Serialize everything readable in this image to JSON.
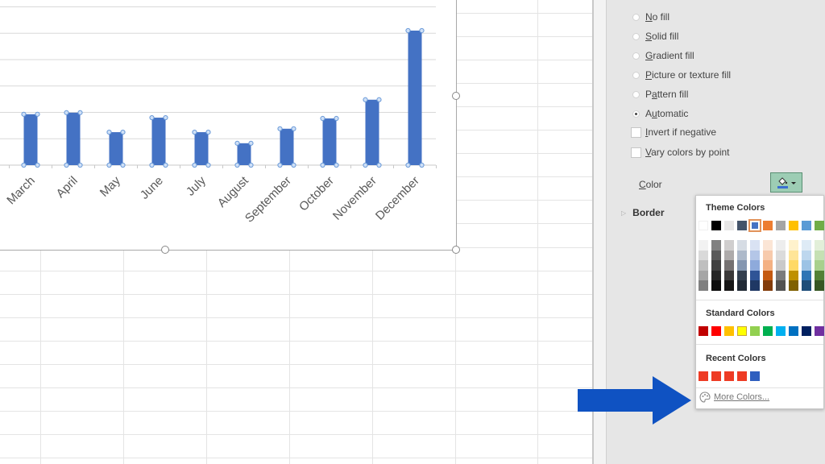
{
  "chart_data": {
    "type": "bar",
    "title": "",
    "xlabel": "",
    "ylabel": "",
    "categories": [
      "March",
      "April",
      "May",
      "June",
      "July",
      "August",
      "September",
      "October",
      "November",
      "December"
    ],
    "values": [
      1.93,
      1.99,
      1.25,
      1.8,
      1.25,
      0.83,
      1.38,
      1.77,
      2.48,
      5.1
    ],
    "value_units": "gridline intervals (axis labels not visible)",
    "ylim": [
      0,
      6
    ],
    "grid": true,
    "legend": "none",
    "bar_color": "#4472C4",
    "selected": true
  },
  "format_panel": {
    "fill_options": [
      {
        "label": "No fill",
        "accel": "N",
        "selected": false
      },
      {
        "label": "Solid fill",
        "accel": "S",
        "selected": false
      },
      {
        "label": "Gradient fill",
        "accel": "G",
        "selected": false
      },
      {
        "label": "Picture or texture fill",
        "accel": "P",
        "selected": false
      },
      {
        "label": "Pattern fill",
        "accel": "a",
        "selected": false
      },
      {
        "label": "Automatic",
        "accel": "u",
        "selected": true
      }
    ],
    "checkboxes": [
      {
        "label": "Invert if negative",
        "checked": false
      },
      {
        "label": "Vary colors by point",
        "checked": false
      }
    ],
    "color_label": "Color",
    "color_button_icon": "paint-bucket-icon",
    "border_label": "Border"
  },
  "color_picker": {
    "theme_header": "Theme Colors",
    "theme_colors": [
      "#FFFFFF",
      "#000000",
      "#E7E6E6",
      "#44546A",
      "#4472C4",
      "#ED7D31",
      "#A5A5A5",
      "#FFC000",
      "#5B9BD5",
      "#70AD47"
    ],
    "theme_selected_index": 4,
    "theme_shades": [
      [
        "#F2F2F2",
        "#D9D9D9",
        "#BFBFBF",
        "#A6A6A6",
        "#808080"
      ],
      [
        "#808080",
        "#595959",
        "#404040",
        "#262626",
        "#0D0D0D"
      ],
      [
        "#D0CECE",
        "#AEABAB",
        "#757171",
        "#3A3838",
        "#171616"
      ],
      [
        "#D6DCE4",
        "#ADB9CA",
        "#8496B0",
        "#333F4F",
        "#222A35"
      ],
      [
        "#D9E2F3",
        "#B4C6E7",
        "#8EAADB",
        "#2F5496",
        "#1F3864"
      ],
      [
        "#FBE5D5",
        "#F7CAAC",
        "#F4B183",
        "#C55A11",
        "#833C0B"
      ],
      [
        "#EDEDED",
        "#DBDBDB",
        "#C9C9C9",
        "#7B7B7B",
        "#525252"
      ],
      [
        "#FFF2CC",
        "#FFE598",
        "#FFD965",
        "#BF9000",
        "#7F6000"
      ],
      [
        "#DEEBF6",
        "#BDD7EE",
        "#9CC3E5",
        "#2E75B5",
        "#1E4E79"
      ],
      [
        "#E2EFD9",
        "#C5E0B3",
        "#A8D08D",
        "#538135",
        "#375623"
      ]
    ],
    "standard_header": "Standard Colors",
    "standard_colors": [
      "#C00000",
      "#FF0000",
      "#FFC000",
      "#FFFF00",
      "#92D050",
      "#00B050",
      "#00B0F0",
      "#0070C0",
      "#002060",
      "#7030A0"
    ],
    "recent_header": "Recent Colors",
    "recent_colors": [
      "#EE3B24",
      "#EE3B24",
      "#EE3B24",
      "#EE3B24",
      "#2F5FBF"
    ],
    "more_colors_label": "More Colors...",
    "more_colors_icon": "palette-icon"
  },
  "annotation": {
    "arrow_icon": "arrow-right-icon",
    "arrow_color": "#0F52C2"
  }
}
